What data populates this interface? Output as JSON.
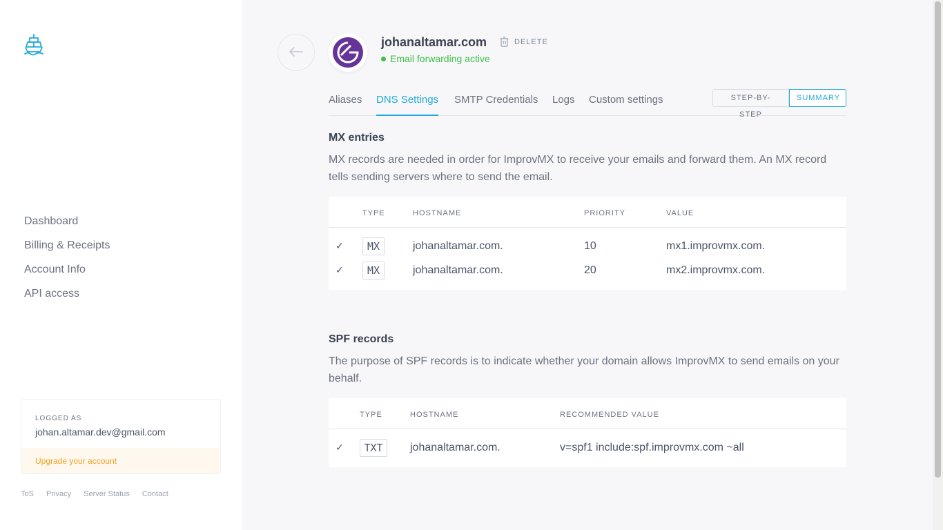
{
  "sidebar": {
    "nav": [
      "Dashboard",
      "Billing & Receipts",
      "Account Info",
      "API access"
    ],
    "account": {
      "label": "LOGGED AS",
      "email": "johan.altamar.dev@gmail.com",
      "upgrade": "Upgrade your account"
    },
    "footer": [
      "ToS",
      "Privacy",
      "Server Status",
      "Contact"
    ]
  },
  "header": {
    "domain": "johanaltamar.com",
    "delete_label": "DELETE",
    "status": "Email forwarding active"
  },
  "tabs": [
    "Aliases",
    "DNS Settings",
    "SMTP Credentials",
    "Logs",
    "Custom settings"
  ],
  "active_tab": "DNS Settings",
  "view_toggle": [
    "STEP-BY-STEP",
    "SUMMARY"
  ],
  "mx": {
    "title": "MX entries",
    "description": "MX records are needed in order for ImprovMX to receive your emails and forward them. An MX record tells sending servers where to send the email.",
    "headers": [
      "TYPE",
      "HOSTNAME",
      "PRIORITY",
      "VALUE"
    ],
    "rows": [
      {
        "check": "✓",
        "type": "MX",
        "hostname": "johanaltamar.com.",
        "priority": "10",
        "value": "mx1.improvmx.com."
      },
      {
        "check": "✓",
        "type": "MX",
        "hostname": "johanaltamar.com.",
        "priority": "20",
        "value": "mx2.improvmx.com."
      }
    ]
  },
  "spf": {
    "title": "SPF records",
    "description": "The purpose of SPF records is to indicate whether your domain allows ImprovMX to send emails on your behalf.",
    "headers": [
      "TYPE",
      "HOSTNAME",
      "RECOMMENDED VALUE"
    ],
    "rows": [
      {
        "check": "✓",
        "type": "TXT",
        "hostname": "johanaltamar.com.",
        "value": "v=spf1 include:spf.improvmx.com ~all"
      }
    ]
  },
  "colors": {
    "accent": "#1fa9d8",
    "success": "#3ec145",
    "upgrade": "#f0a020",
    "avatar": "#663399"
  }
}
